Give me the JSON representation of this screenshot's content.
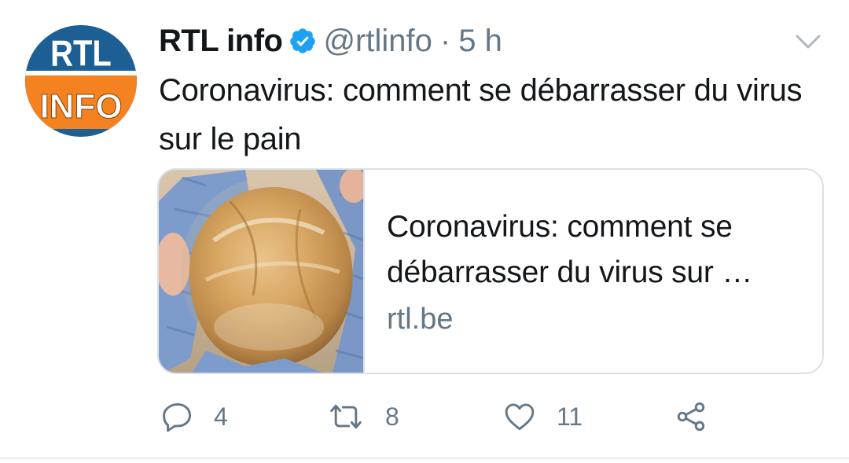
{
  "tweet": {
    "author": {
      "display_name": "RTL info",
      "handle": "@rtlinfo",
      "verified": true,
      "avatar_logo": {
        "line1": "RTL",
        "line2": "INFO"
      }
    },
    "separator": "·",
    "time": "5 h",
    "text": "Coronavirus: comment se débarrasser du virus sur le pain",
    "card": {
      "title_line1": "Coronavirus: comment se",
      "title_line2": "débarrasser du virus sur …",
      "domain": "rtl.be"
    },
    "actions": {
      "reply_count": "4",
      "retweet_count": "8",
      "like_count": "11"
    }
  },
  "colors": {
    "text_primary": "#14171a",
    "text_secondary": "#657786",
    "verified_blue": "#1da1f2",
    "border": "#d9e1e8",
    "avatar_blue": "#1b5f95",
    "logo_orange": "#f58220"
  },
  "icons": {
    "menu": "chevron-down-icon",
    "reply": "reply-icon",
    "retweet": "retweet-icon",
    "like": "heart-icon",
    "share": "share-icon",
    "verified": "verified-badge-icon"
  }
}
